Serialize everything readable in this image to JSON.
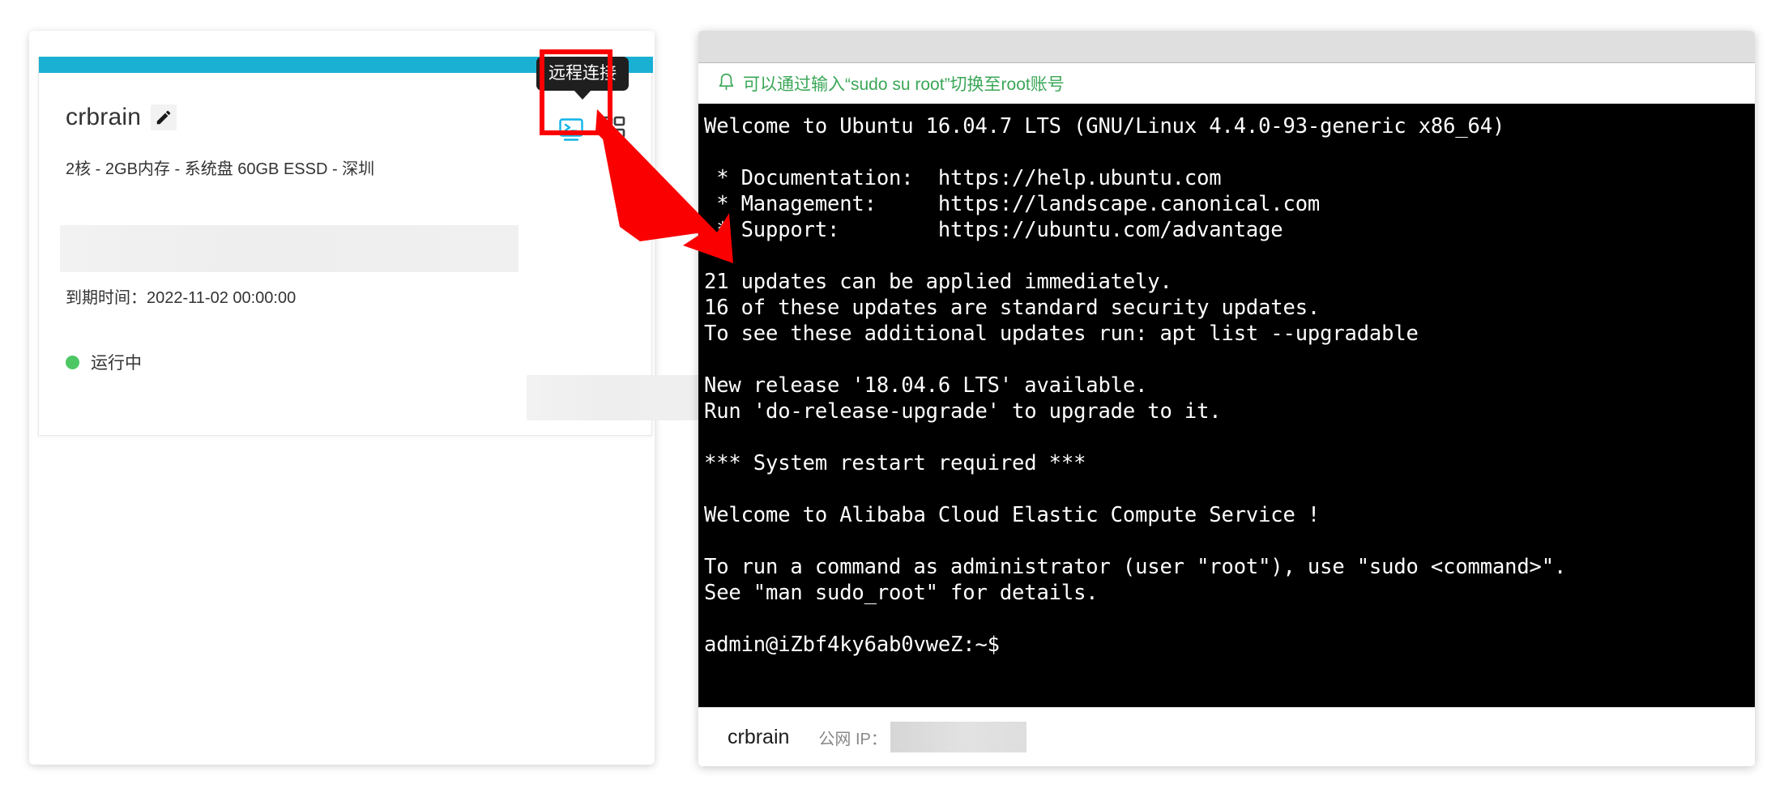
{
  "instance_card": {
    "name": "crbrain",
    "edit_icon": "pencil-icon",
    "spec": "2核 - 2GB内存 - 系统盘 60GB ESSD - 深圳",
    "expire": "到期时间：2022-11-02 00:00:00",
    "status_text": "运行中",
    "status_color": "#4cc764",
    "accent_color": "#1ab0d3",
    "actions": {
      "remote_connect_icon": "terminal-icon",
      "more_apps_icon": "grid-apps-icon"
    }
  },
  "tooltip": {
    "label": "远程连接"
  },
  "annotation": {
    "box_color": "#fb0000",
    "arrow_color": "#fb0000"
  },
  "terminal": {
    "notice": {
      "icon": "bell-icon",
      "text": "可以通过输入“sudo su root”切换至root账号",
      "color": "#3aa757"
    },
    "output": "Welcome to Ubuntu 16.04.7 LTS (GNU/Linux 4.4.0-93-generic x86_64)\n\n * Documentation:  https://help.ubuntu.com\n * Management:     https://landscape.canonical.com\n * Support:        https://ubuntu.com/advantage\n\n21 updates can be applied immediately.\n16 of these updates are standard security updates.\nTo see these additional updates run: apt list --upgradable\n\nNew release '18.04.6 LTS' available.\nRun 'do-release-upgrade' to upgrade to it.\n\n*** System restart required ***\n\nWelcome to Alibaba Cloud Elastic Compute Service !\n\nTo run a command as administrator (user \"root\"), use \"sudo <command>\".\nSee \"man sudo_root\" for details.\n\nadmin@iZbf4ky6ab0vweZ:~$ ",
    "statusbar": {
      "instance_name": "crbrain",
      "ip_label": "公网 IP：",
      "ip_value": ""
    }
  }
}
